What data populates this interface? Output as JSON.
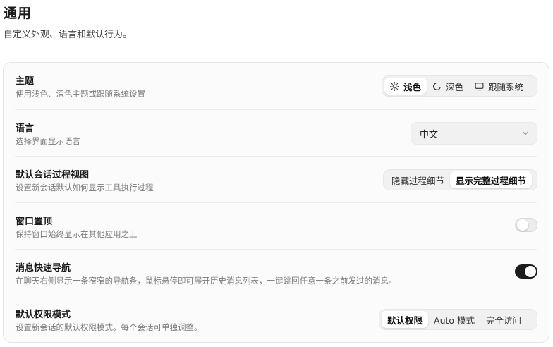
{
  "header": {
    "title": "通用",
    "subtitle": "自定义外观、语言和默认行为。"
  },
  "settings": {
    "theme": {
      "title": "主题",
      "description": "使用浅色、深色主题或跟随系统设置",
      "options": [
        {
          "label": "浅色",
          "icon": "sun-icon",
          "selected": true
        },
        {
          "label": "深色",
          "icon": "moon-icon",
          "selected": false
        },
        {
          "label": "跟随系统",
          "icon": "monitor-icon",
          "selected": false
        }
      ]
    },
    "language": {
      "title": "语言",
      "description": "选择界面显示语言",
      "value": "中文",
      "icon": "chevron-down-icon"
    },
    "session_view": {
      "title": "默认会话过程视图",
      "description": "设置新会话默认如何显示工具执行过程",
      "options": [
        {
          "label": "隐藏过程细节",
          "selected": false
        },
        {
          "label": "显示完整过程细节",
          "selected": true
        }
      ]
    },
    "always_on_top": {
      "title": "窗口置顶",
      "description": "保持窗口始终显示在其他应用之上",
      "enabled": false
    },
    "quick_nav": {
      "title": "消息快速导航",
      "description": "在聊天右侧显示一条窄窄的导航条，鼠标悬停即可展开历史消息列表，一键跳回任意一条之前发过的消息。",
      "enabled": true
    },
    "permission_mode": {
      "title": "默认权限模式",
      "description": "设置新会话的默认权限模式。每个会话可单独调整。",
      "options": [
        {
          "label": "默认权限",
          "selected": true
        },
        {
          "label": "Auto 模式",
          "selected": false
        },
        {
          "label": "完全访问",
          "selected": false
        }
      ]
    }
  },
  "colors": {
    "toggle_on": "#1c1c1c",
    "toggle_off": "#ececec",
    "card_bg": "#fbfbfb"
  }
}
